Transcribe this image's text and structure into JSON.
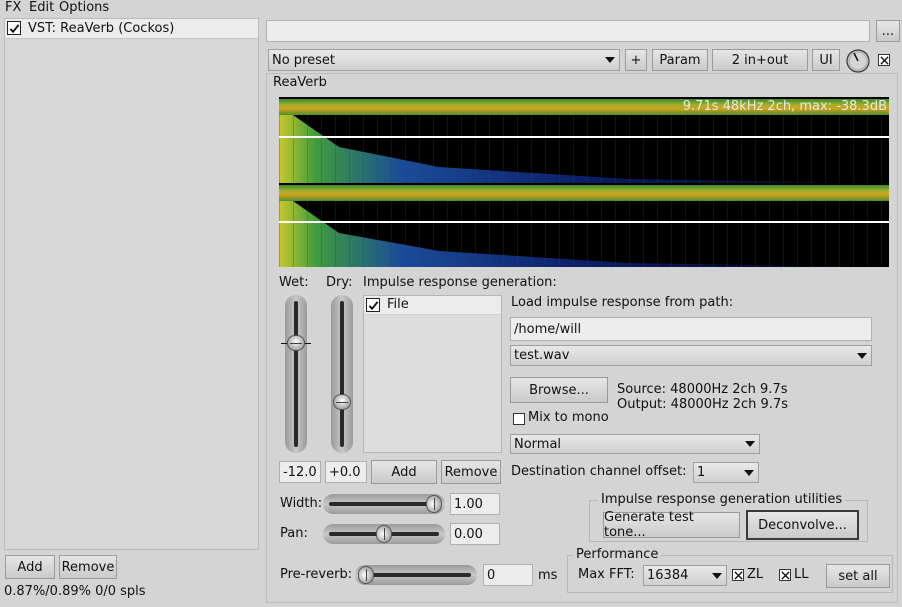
{
  "menu": {
    "fx": "FX",
    "edit": "Edit",
    "options": "Options"
  },
  "fx_chain": {
    "items": [
      {
        "label": "VST: ReaVerb (Cockos)",
        "enabled": true
      }
    ],
    "add_label": "Add",
    "remove_label": "Remove",
    "status": "0.87%/0.89% 0/0 spls"
  },
  "top_bar": {
    "name_value": "",
    "more_label": "...",
    "preset_value": "No preset",
    "plus_label": "+",
    "param_label": "Param",
    "io_label": "2 in+out",
    "ui_label": "UI"
  },
  "plugin": {
    "title": "ReaVerb",
    "waveform_info": "9.71s 48kHz 2ch, max: -38.3dB",
    "wet_label": "Wet:",
    "dry_label": "Dry:",
    "wet_value": "-12.0",
    "dry_value": "+0.0",
    "wet_level": 0.73,
    "dry_level": 0.29,
    "ir_gen_label": "Impulse response generation:",
    "ir_items": [
      {
        "label": "File",
        "checked": true
      }
    ],
    "add_label": "Add",
    "remove_label": "Remove",
    "load_label": "Load impulse response from path:",
    "path_value": "/home/will",
    "file_value": "test.wav",
    "browse_label": "Browse...",
    "source_info": "Source: 48000Hz 2ch 9.7s",
    "output_info": "Output: 48000Hz 2ch 9.7s",
    "mix_to_mono_label": "Mix to mono",
    "mix_to_mono_checked": false,
    "mode_value": "Normal",
    "dest_offset_label": "Destination channel offset:",
    "dest_offset_value": "1",
    "width_label": "Width:",
    "width_value": "1.00",
    "width_level": 1.0,
    "pan_label": "Pan:",
    "pan_value": "0.00",
    "pan_level": 0.5,
    "prereverb_label": "Pre-reverb:",
    "prereverb_value": "0",
    "prereverb_unit": "ms",
    "prereverb_level": 0.0,
    "utilities_title": "Impulse response generation utilities",
    "gen_tone_label": "Generate test tone...",
    "deconvolve_label": "Deconvolve...",
    "performance_title": "Performance",
    "max_fft_label": "Max FFT:",
    "max_fft_value": "16384",
    "zl_label": "ZL",
    "zl_checked": true,
    "ll_label": "LL",
    "ll_checked": true,
    "set_all_label": "set all"
  }
}
